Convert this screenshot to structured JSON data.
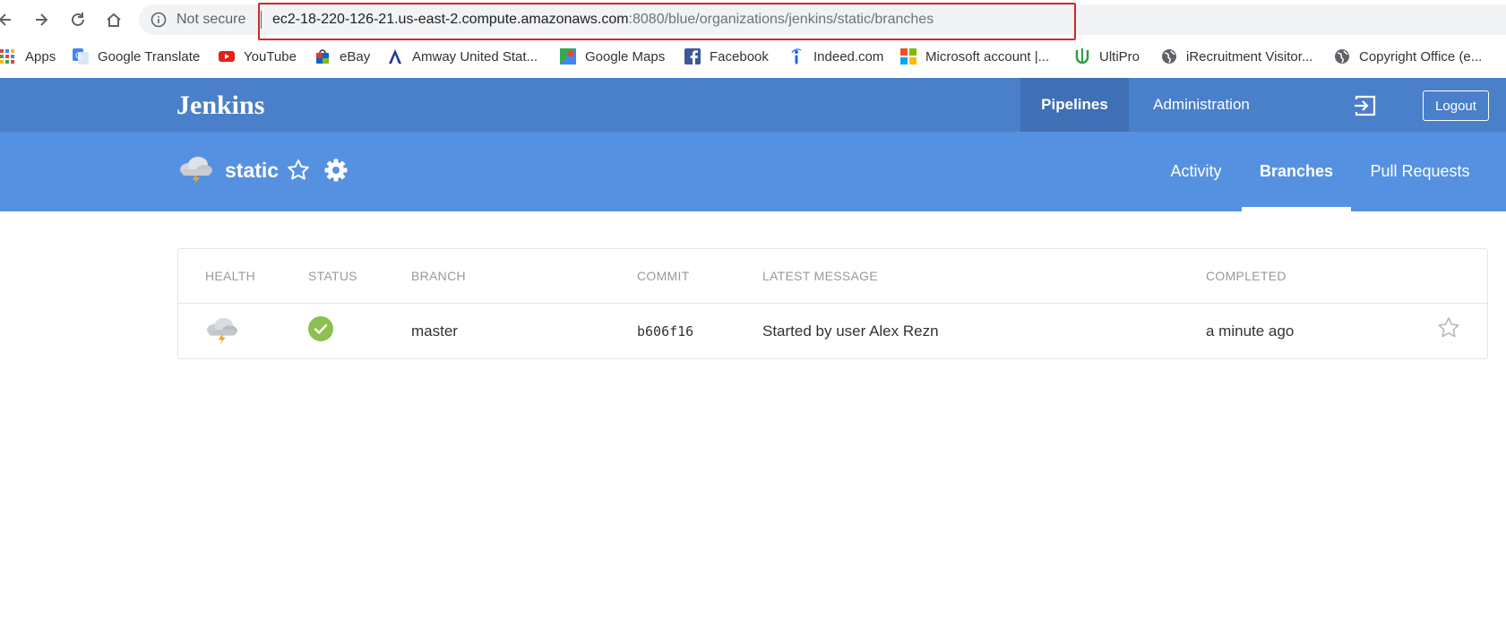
{
  "browser": {
    "security_label": "Not secure",
    "url_host": "ec2-18-220-126-21.us-east-2.compute.amazonaws.com",
    "url_path": ":8080/blue/organizations/jenkins/static/branches",
    "bookmarks": [
      {
        "label": "Apps",
        "icon": "apps-grid-icon"
      },
      {
        "label": "Google Translate",
        "icon": "google-translate-icon"
      },
      {
        "label": "YouTube",
        "icon": "youtube-icon"
      },
      {
        "label": "eBay",
        "icon": "ebay-icon"
      },
      {
        "label": "Amway United Stat...",
        "icon": "amway-icon"
      },
      {
        "label": "Google Maps",
        "icon": "google-maps-icon"
      },
      {
        "label": "Facebook",
        "icon": "facebook-icon"
      },
      {
        "label": "Indeed.com",
        "icon": "indeed-icon"
      },
      {
        "label": "Microsoft account |...",
        "icon": "microsoft-icon"
      },
      {
        "label": "UltiPro",
        "icon": "ultipro-icon"
      },
      {
        "label": "iRecruitment Visitor...",
        "icon": "globe-icon"
      },
      {
        "label": "Copyright Office (e...",
        "icon": "globe-icon"
      }
    ]
  },
  "header": {
    "logo": "Jenkins",
    "nav": [
      {
        "label": "Pipelines",
        "active": true
      },
      {
        "label": "Administration",
        "active": false
      }
    ],
    "logout_label": "Logout"
  },
  "pipeline": {
    "name": "static",
    "tabs": [
      {
        "label": "Activity",
        "active": false
      },
      {
        "label": "Branches",
        "active": true
      },
      {
        "label": "Pull Requests",
        "active": false
      }
    ]
  },
  "table": {
    "columns": [
      "HEALTH",
      "STATUS",
      "BRANCH",
      "COMMIT",
      "LATEST MESSAGE",
      "COMPLETED"
    ],
    "rows": [
      {
        "health": "cloudy-storm-icon",
        "status": "success-check-icon",
        "branch": "master",
        "commit": "b606f16",
        "message": "Started by user Alex Rezn",
        "completed": "a minute ago"
      }
    ]
  },
  "colors": {
    "header_bg": "#4a7fc9",
    "subheader_bg": "#5591e0",
    "success_green": "#8cc04f",
    "url_highlight": "#cc2a2a"
  }
}
